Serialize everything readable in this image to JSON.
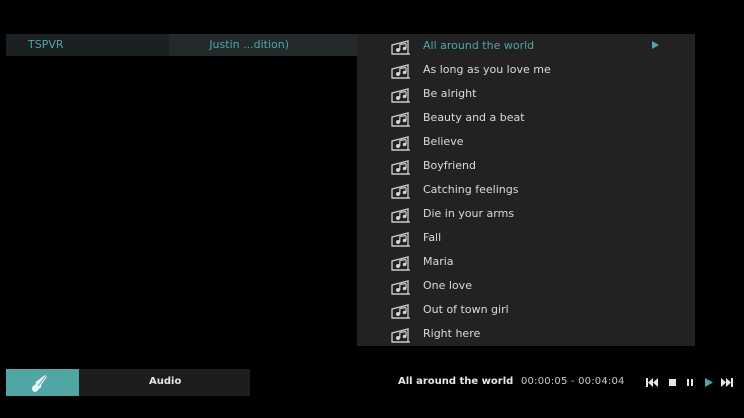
{
  "browser": {
    "source_name": "TSPVR",
    "album_name": "Justin ...dition)"
  },
  "tracks": [
    {
      "label": "All around the world",
      "active": true
    },
    {
      "label": "As long as you love me"
    },
    {
      "label": "Be alright"
    },
    {
      "label": "Beauty and a beat"
    },
    {
      "label": "Believe"
    },
    {
      "label": "Boyfriend"
    },
    {
      "label": "Catching feelings"
    },
    {
      "label": "Die in your arms"
    },
    {
      "label": "Fall"
    },
    {
      "label": "Maria"
    },
    {
      "label": "One love"
    },
    {
      "label": "Out of town girl"
    },
    {
      "label": "Right here"
    }
  ],
  "bottom_bar": {
    "category": "Audio",
    "now_playing": "All around the world",
    "time": "00:00:05 - 00:04:04"
  },
  "icons": {
    "track": "music-note-icon",
    "selected_marker": "play-arrow-icon",
    "category": "guitar-icon",
    "controls": [
      "previous-icon",
      "stop-icon",
      "pause-icon",
      "play-icon",
      "next-icon"
    ]
  },
  "colors": {
    "accent": "#4fa6a3",
    "panel": "#222222",
    "background": "#000000"
  }
}
